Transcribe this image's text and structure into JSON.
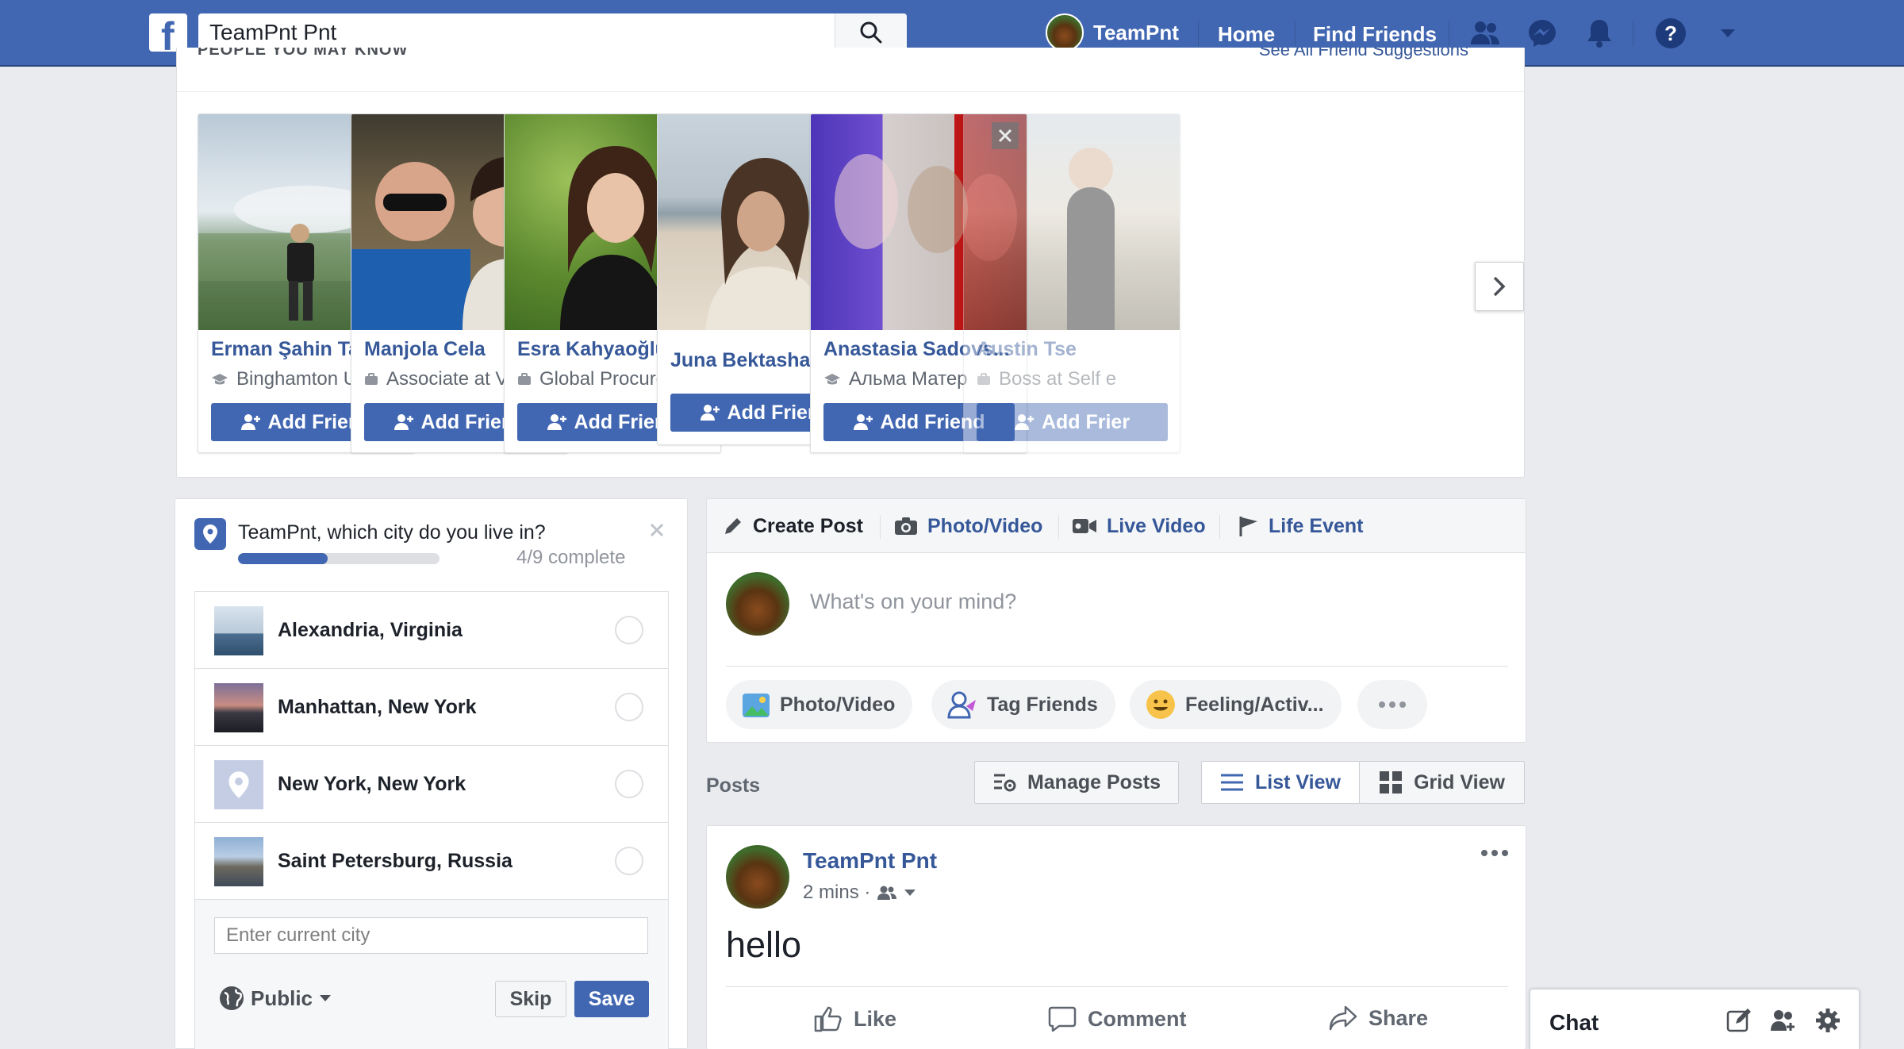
{
  "colors": {
    "brand": "#4267b2",
    "link": "#365899",
    "background": "#e9ebee"
  },
  "topbar": {
    "logo_glyph": "f",
    "search_value": "TeamPnt Pnt",
    "profile_name": "TeamPnt",
    "home_label": "Home",
    "find_friends_label": "Find Friends",
    "icons": [
      "friend-requests-icon",
      "messenger-icon",
      "notifications-icon",
      "help-icon",
      "account-menu-icon"
    ]
  },
  "pymk": {
    "title": "PEOPLE YOU MAY KNOW",
    "see_all": "See All Friend Suggestions",
    "add_label": "Add Friend",
    "cards": [
      {
        "name": "Erman Şahin Tatar",
        "subtitle": "Binghamton Univ...",
        "sub_icon": "school-icon"
      },
      {
        "name": "Manjola Cela",
        "subtitle": "Associate at Velu...",
        "sub_icon": "work-icon"
      },
      {
        "name": "Esra Kahyaoğlu",
        "subtitle": "Global Procurem...",
        "sub_icon": "work-icon"
      },
      {
        "name": "Juna Bektasha",
        "subtitle": "",
        "sub_icon": ""
      },
      {
        "name": "Anastasia Sadovs...",
        "subtitle": "Альма Матер",
        "sub_icon": "school-icon"
      },
      {
        "name": "Austin Tse",
        "subtitle": "Boss at Self e",
        "sub_icon": "work-icon"
      }
    ],
    "add_label_partial": "Add Frier"
  },
  "city": {
    "question": "TeamPnt, which city do you live in?",
    "progress_fraction": 0.444,
    "progress_text": "4/9 complete",
    "options": [
      {
        "name": "Alexandria, Virginia"
      },
      {
        "name": "Manhattan, New York"
      },
      {
        "name": "New York, New York"
      },
      {
        "name": "Saint Petersburg, Russia"
      }
    ],
    "input_placeholder": "Enter current city",
    "privacy_label": "Public",
    "skip_label": "Skip",
    "save_label": "Save"
  },
  "composer": {
    "tabs": {
      "create_post": "Create Post",
      "photo_video": "Photo/Video",
      "live_video": "Live Video",
      "life_event": "Life Event"
    },
    "placeholder": "What's on your mind?",
    "pills": {
      "photo_video": "Photo/Video",
      "tag_friends": "Tag Friends",
      "feeling": "Feeling/Activ..."
    }
  },
  "posts_header": {
    "label": "Posts",
    "manage_label": "Manage Posts",
    "list_view_label": "List View",
    "grid_view_label": "Grid View"
  },
  "post": {
    "author": "TeamPnt Pnt",
    "time": "2 mins ·",
    "text": "hello",
    "like_label": "Like",
    "comment_label": "Comment",
    "share_label": "Share"
  },
  "chat": {
    "title": "Chat"
  }
}
